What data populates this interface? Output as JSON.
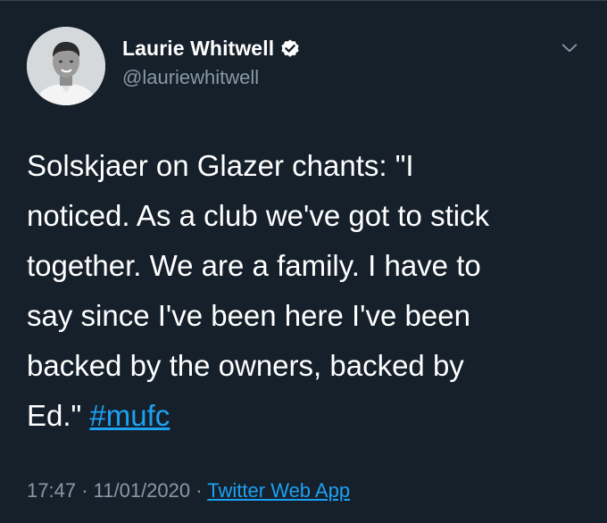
{
  "tweet": {
    "author": {
      "name": "Laurie Whitwell",
      "handle": "@lauriewhitwell",
      "verified_icon": "verified-badge-icon",
      "avatar": "profile-photo"
    },
    "menu_icon": "chevron-down-icon",
    "text_lines": [
      "Solskjaer on Glazer chants: \"I",
      "noticed. As a club we've got to stick",
      "together. We are a family. I have to",
      "say since I've been here I've been",
      "backed by the owners, backed by",
      "Ed.\""
    ],
    "hashtag": "#mufc",
    "time": "17:47",
    "separator": "·",
    "date": "11/01/2020",
    "source": "Twitter Web App"
  },
  "colors": {
    "background": "#15202b",
    "text": "#ffffff",
    "secondary": "#8899a6",
    "accent": "#1da1f2"
  }
}
